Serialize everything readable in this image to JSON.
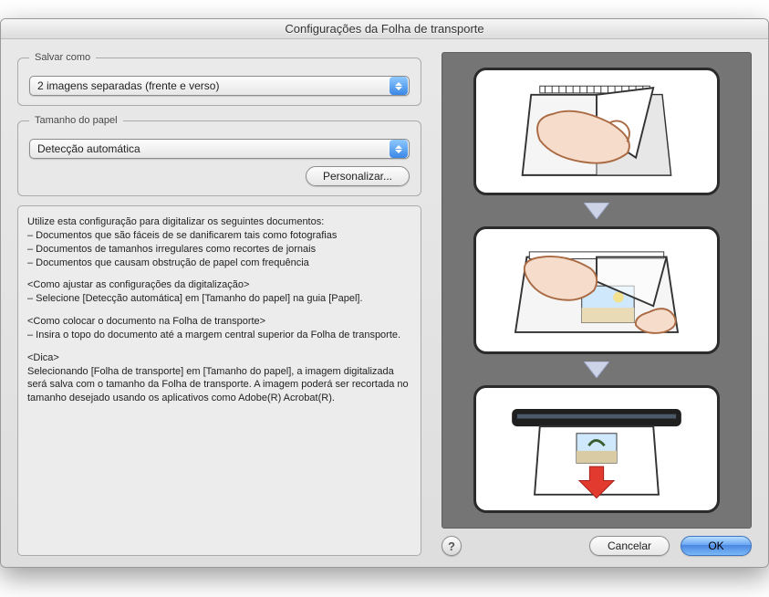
{
  "window": {
    "title": "Configurações da Folha de transporte"
  },
  "save_as": {
    "legend": "Salvar como",
    "selected": "2 imagens separadas (frente e verso)"
  },
  "paper_size": {
    "legend": "Tamanho do papel",
    "selected": "Detecção automática",
    "customize_button": "Personalizar..."
  },
  "description": {
    "intro": "Utilize esta configuração para digitalizar os seguintes documentos:",
    "b1": "– Documentos que são fáceis de se danificarem tais como fotografias",
    "b2": "– Documentos de tamanhos irregulares como recortes de jornais",
    "b3": "– Documentos que causam obstrução de papel com frequência",
    "h1": "<Como ajustar as configurações da digitalização>",
    "t1": "– Selecione [Detecção automática] em [Tamanho do papel] na guia [Papel].",
    "h2": "<Como colocar o documento na Folha de transporte>",
    "t2": "– Insira o topo do documento até a margem central superior da Folha de transporte.",
    "h3": "<Dica>",
    "t3": "Selecionando [Folha de transporte] em [Tamanho do papel], a imagem digitalizada será salva com o tamanho da Folha de transporte. A imagem poderá ser recortada no tamanho desejado usando os aplicativos como Adobe(R) Acrobat(R)."
  },
  "buttons": {
    "help": "?",
    "cancel": "Cancelar",
    "ok": "OK"
  }
}
